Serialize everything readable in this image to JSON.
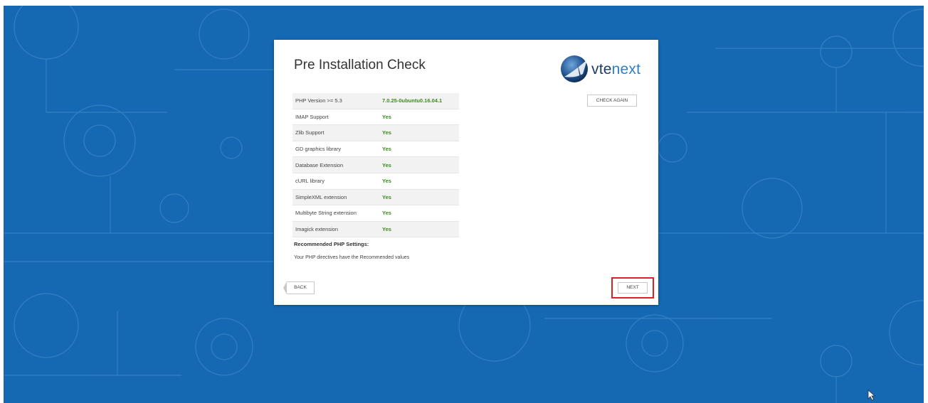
{
  "installer": {
    "title": "Pre Installation Check",
    "logo": {
      "prefix": "vte",
      "suffix": "next"
    },
    "check_again_label": "CHECK AGAIN",
    "checks": [
      {
        "name": "PHP Version >= 5.3",
        "value": "7.0.25-0ubuntu0.16.04.1"
      },
      {
        "name": "IMAP Support",
        "value": "Yes"
      },
      {
        "name": "Zlib Support",
        "value": "Yes"
      },
      {
        "name": "GD graphics library",
        "value": "Yes"
      },
      {
        "name": "Database Extension",
        "value": "Yes"
      },
      {
        "name": "cURL library",
        "value": "Yes"
      },
      {
        "name": "SimpleXML extension",
        "value": "Yes"
      },
      {
        "name": "Multibyte String extension",
        "value": "Yes"
      },
      {
        "name": "Imagick extension",
        "value": "Yes"
      }
    ],
    "recommended_heading": "Recommended PHP Settings:",
    "recommended_text": "Your PHP directives have the Recommended values",
    "back_label": "BACK",
    "next_label": "NEXT"
  },
  "colors": {
    "background": "#1569b3",
    "pass": "#3a8b1a",
    "highlight": "#e02020",
    "brand_dark": "#1a3c6b",
    "brand_accent": "#2e7fc8"
  },
  "icons": {
    "cursor": "mouse-pointer-icon",
    "logo": "vtenext-globe-icon"
  }
}
